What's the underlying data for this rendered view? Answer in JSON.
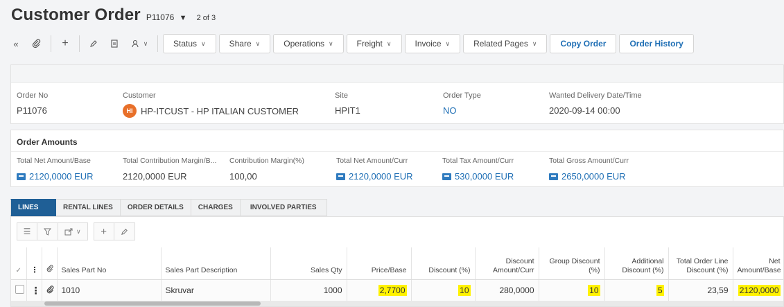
{
  "header": {
    "title": "Customer Order",
    "order_id": "P11076",
    "paging": "2 of 3"
  },
  "toolbar": {
    "icons": [
      "collapse-icon",
      "attachment-icon",
      "add-icon",
      "edit-icon",
      "document-icon",
      "user-settings-icon"
    ],
    "buttons": [
      "Status",
      "Share",
      "Operations",
      "Freight",
      "Invoice",
      "Related Pages"
    ],
    "primary_buttons": [
      "Copy Order",
      "Order History"
    ]
  },
  "order_info": {
    "order_no": {
      "label": "Order No",
      "value": "P11076"
    },
    "customer": {
      "label": "Customer",
      "initials": "HI",
      "value": "HP-ITCUST - HP ITALIAN CUSTOMER"
    },
    "site": {
      "label": "Site",
      "value": "HPIT1"
    },
    "order_type": {
      "label": "Order Type",
      "value": "NO"
    },
    "wanted_delivery": {
      "label": "Wanted Delivery Date/Time",
      "value": "2020-09-14 00:00"
    }
  },
  "amounts": {
    "title": "Order Amounts",
    "items": [
      {
        "label": "Total Net Amount/Base",
        "value": "2120,0000 EUR"
      },
      {
        "label": "Total Contribution Margin/B...",
        "value": "2120,0000 EUR"
      },
      {
        "label": "Contribution Margin(%)",
        "value": "100,00"
      },
      {
        "label": "Total Net Amount/Curr",
        "value": "2120,0000 EUR"
      },
      {
        "label": "Total Tax Amount/Curr",
        "value": "530,0000 EUR"
      },
      {
        "label": "Total Gross Amount/Curr",
        "value": "2650,0000 EUR"
      }
    ]
  },
  "tabs": [
    "LINES",
    "RENTAL LINES",
    "ORDER DETAILS",
    "CHARGES",
    "INVOLVED PARTIES"
  ],
  "grid": {
    "headers": {
      "sales_part_no": "Sales Part No",
      "description": "Sales Part Description",
      "qty": "Sales Qty",
      "price": "Price/Base",
      "discount": "Discount (%)",
      "discount_amount": "Discount Amount/Curr",
      "group_discount": "Group Discount (%)",
      "additional_discount": "Additional Discount (%)",
      "total_line_discount": "Total Order Line Discount (%)",
      "net_amount": "Net Amount/Base"
    },
    "row": {
      "sales_part_no": "1010",
      "description": "Skruvar",
      "qty": "1000",
      "price": "2,7700",
      "discount": "10",
      "discount_amount": "280,0000",
      "group_discount": "10",
      "additional_discount": "5",
      "total_line_discount": "23,59",
      "net_amount": "2120,0000"
    }
  },
  "colors": {
    "accent": "#1f6fb5",
    "tab_active": "#1f5f96",
    "avatar": "#e8702a",
    "highlight": "#fff200"
  }
}
